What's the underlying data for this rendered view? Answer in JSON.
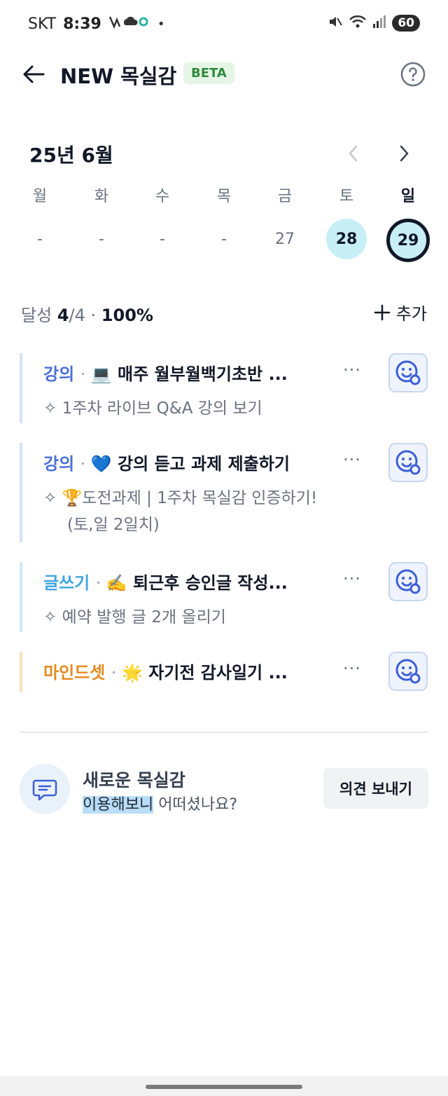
{
  "status": {
    "carrier": "SKT",
    "time": "8:39",
    "battery": "60"
  },
  "header": {
    "title": "NEW 목실감",
    "badge": "BETA"
  },
  "calendar": {
    "month": "25년 6월",
    "weekdays": [
      "월",
      "화",
      "수",
      "목",
      "금",
      "토",
      "일"
    ],
    "days": [
      "-",
      "-",
      "-",
      "-",
      "27",
      "28",
      "29"
    ]
  },
  "summary": {
    "label": "달성",
    "done": "4",
    "sep": "/4",
    "bullet": "·",
    "percent": "100%",
    "add_label": "추가"
  },
  "tasks": [
    {
      "category": "강의",
      "title": "💻 매주 월부월백기초반 ...",
      "sub": "1주차 라이브 Q&A 강의 보기",
      "color": "#4a6fd6",
      "bar": "#d6e1f7"
    },
    {
      "category": "강의",
      "title": "💙 강의 듣고 과제 제출하기",
      "sub": "🏆도전과제 | 1주차 목실감 인증하기! (토,일 2일치)",
      "color": "#4a6fd6",
      "bar": "#d6e1f7"
    },
    {
      "category": "글쓰기",
      "title": "✍️ 퇴근후 승인글 작성...",
      "sub": "예약 발행 글 2개 올리기",
      "color": "#3ea6e2",
      "bar": "#cdeaf8"
    },
    {
      "category": "마인드셋",
      "title": "🌟 자기전 감사일기 ...",
      "sub": "",
      "color": "#e58a1f",
      "bar": "#fbe2bd"
    }
  ],
  "more_label": "···",
  "feedback": {
    "title": "새로운 목실감",
    "sub_highlight": "이용해보니",
    "sub_rest": " 어떠셨나요?",
    "button": "의견 보내기"
  }
}
